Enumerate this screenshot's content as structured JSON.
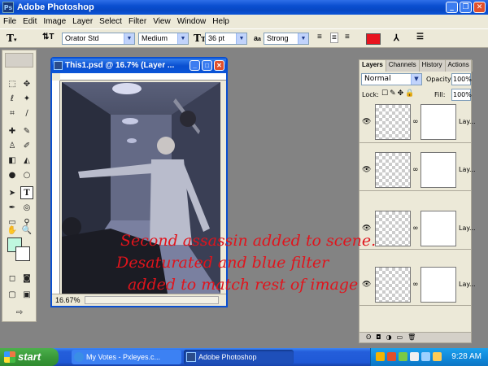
{
  "window": {
    "title": "Adobe Photoshop",
    "icon": "Ps"
  },
  "menu": {
    "items": [
      "File",
      "Edit",
      "Image",
      "Layer",
      "Select",
      "Filter",
      "View",
      "Window",
      "Help"
    ]
  },
  "options": {
    "font_family": "Orator Std",
    "font_style": "Medium",
    "font_size": "36 pt",
    "aa_label": "a",
    "antialias": "Strong",
    "text_color": "#e8141e"
  },
  "toolbox": {
    "foreground_color": "#bff7df",
    "background_color": "#ffffff"
  },
  "document": {
    "title": "This1.psd @ 16.7% (Layer ...",
    "zoom": "16.67%"
  },
  "layers_panel": {
    "tabs": [
      "Layers",
      "Channels",
      "History",
      "Actions"
    ],
    "blend_mode": "Normal",
    "opacity_label": "Opacity:",
    "opacity": "100%",
    "lock_label": "Lock:",
    "fill_label": "Fill:",
    "fill": "100%",
    "layer_names": [
      "Lay...",
      "Lay...",
      "Lay...",
      "Lay..."
    ]
  },
  "taskbar": {
    "start_label": "start",
    "items": [
      "My Votes - Pxleyes.c...",
      "Adobe Photoshop"
    ],
    "clock": "9:28 AM"
  },
  "annotation": {
    "line1": "Second assassin added to scene.",
    "line2": "Desaturated and blue filter",
    "line3": "added to match rest of image",
    "color": "#e0141c"
  }
}
